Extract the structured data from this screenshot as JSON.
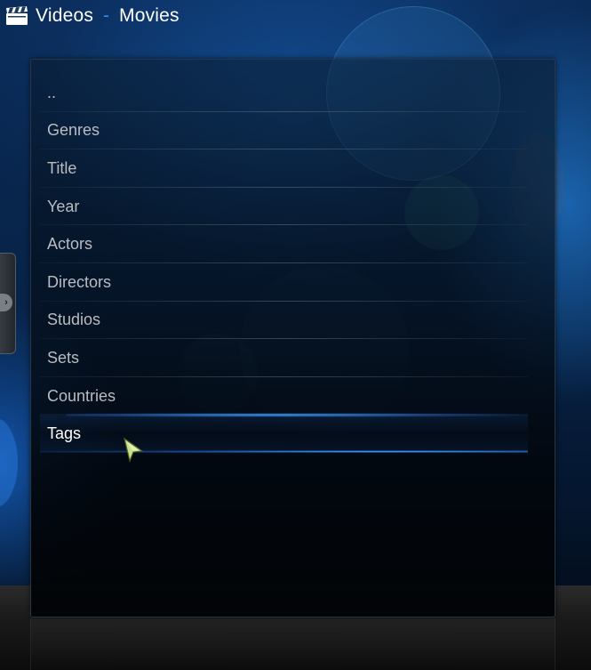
{
  "header": {
    "section": "Videos",
    "separator": "-",
    "subsection": "Movies",
    "icon": "clapperboard-icon"
  },
  "side_tab": {
    "icon": "chevron-right-icon"
  },
  "list": {
    "items": [
      {
        "label": "..",
        "selected": false
      },
      {
        "label": "Genres",
        "selected": false
      },
      {
        "label": "Title",
        "selected": false
      },
      {
        "label": "Year",
        "selected": false
      },
      {
        "label": "Actors",
        "selected": false
      },
      {
        "label": "Directors",
        "selected": false
      },
      {
        "label": "Studios",
        "selected": false
      },
      {
        "label": "Sets",
        "selected": false
      },
      {
        "label": "Countries",
        "selected": false
      },
      {
        "label": "Tags",
        "selected": true
      }
    ]
  },
  "colors": {
    "accent": "#2f8fe0",
    "text_normal": "#b9bcc0",
    "text_selected": "#ffffff",
    "cursor": "#c8e08a"
  }
}
